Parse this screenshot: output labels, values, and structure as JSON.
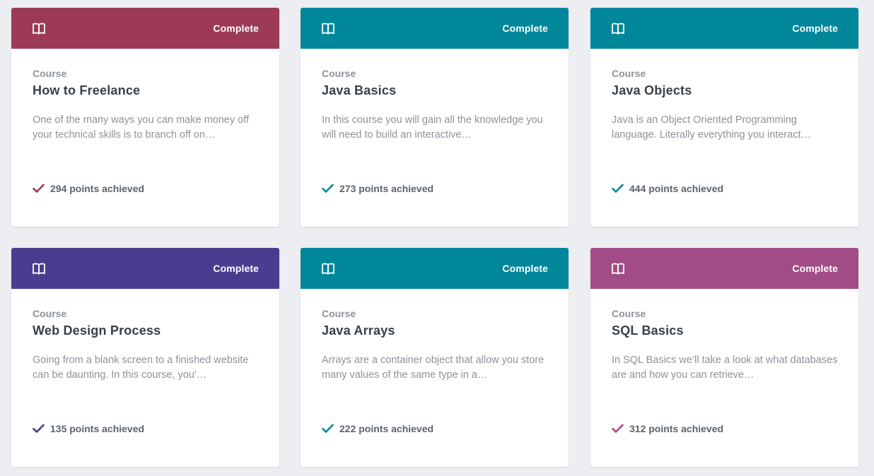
{
  "cards": [
    {
      "status": "Complete",
      "type": "Course",
      "title": "How to Freelance",
      "description": "One of the many ways you can make money off your technical skills is to branch off on…",
      "points": "294 points achieved",
      "color": "#9c3a58"
    },
    {
      "status": "Complete",
      "type": "Course",
      "title": "Java Basics",
      "description": "In this course you will gain all the knowledge you will need to build an interactive…",
      "points": "273 points achieved",
      "color": "#00879a"
    },
    {
      "status": "Complete",
      "type": "Course",
      "title": "Java Objects",
      "description": "Java is an Object Oriented Programming language. Literally everything you interact…",
      "points": "444 points achieved",
      "color": "#00879a"
    },
    {
      "status": "Complete",
      "type": "Course",
      "title": "Web Design Process",
      "description": "Going from a blank screen to a finished website can be daunting. In this course, you'…",
      "points": "135 points achieved",
      "color": "#4a3d8f"
    },
    {
      "status": "Complete",
      "type": "Course",
      "title": "Java Arrays",
      "description": "Arrays are a container object that allow you store many values of the same type in a…",
      "points": "222 points achieved",
      "color": "#00879a"
    },
    {
      "status": "Complete",
      "type": "Course",
      "title": "SQL Basics",
      "description": "In SQL Basics we’ll take a look at what databases are and how you can retrieve…",
      "points": "312 points achieved",
      "color": "#a14c86"
    }
  ],
  "icons": {
    "header": "book-icon",
    "points": "checkmark-icon"
  }
}
